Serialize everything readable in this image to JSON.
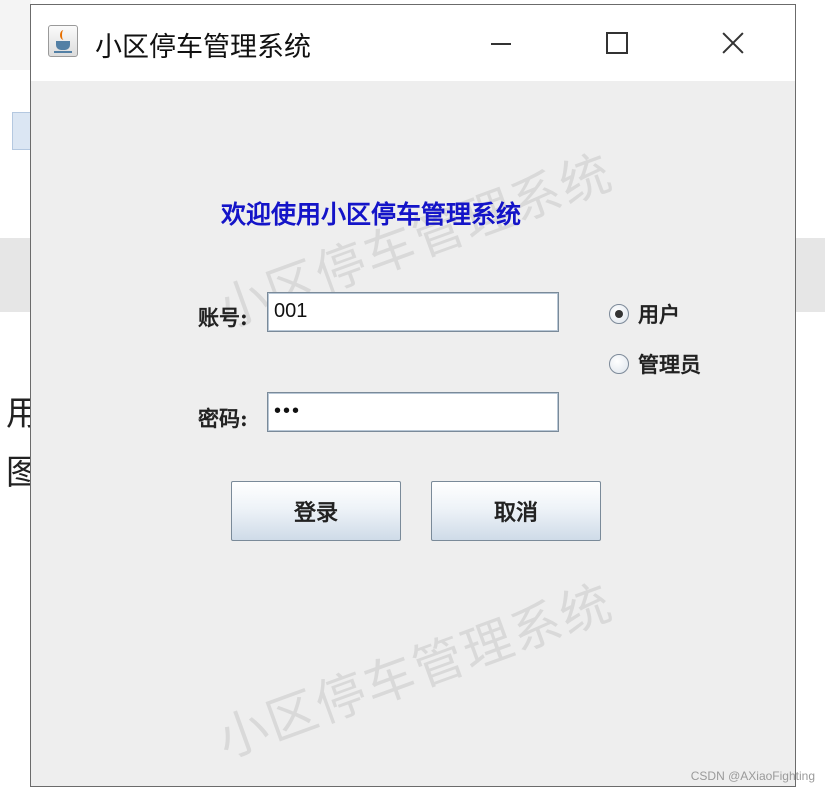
{
  "window": {
    "title": "小区停车管理系统",
    "controls": [
      "minimize",
      "maximize",
      "close"
    ]
  },
  "background": {
    "glyphs": [
      "用",
      "图"
    ]
  },
  "watermark": "小区停车管理系统",
  "login": {
    "welcome": "欢迎使用小区停车管理系统",
    "account_label": "账号:",
    "account_value": "001",
    "password_label": "密码:",
    "password_value": "•••",
    "role_options": [
      {
        "label": "用户",
        "selected": true
      },
      {
        "label": "管理员",
        "selected": false
      }
    ],
    "login_button": "登录",
    "cancel_button": "取消"
  },
  "credit": "CSDN @AXiaoFighting",
  "colors": {
    "welcome_text": "#1414c8",
    "window_bg": "#eeeeee",
    "titlebar_bg": "#ffffff"
  },
  "icons": {
    "app": "java-coffee-cup-icon"
  }
}
